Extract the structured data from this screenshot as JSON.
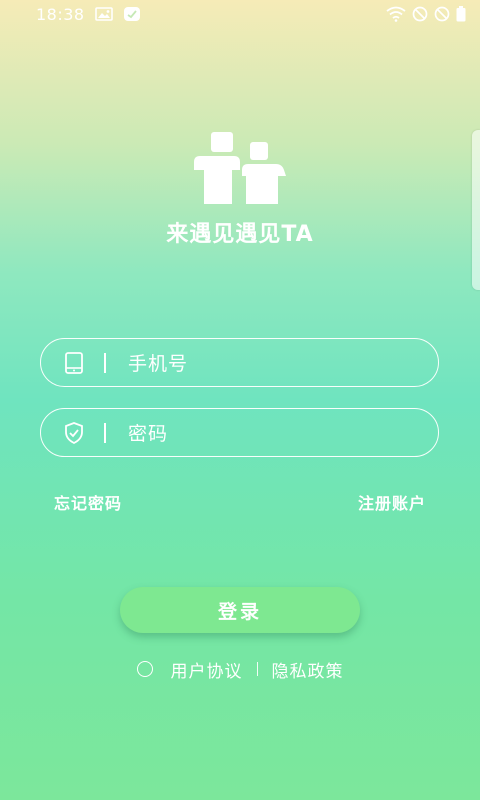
{
  "status_bar": {
    "time": "18:38",
    "left_icons": [
      "image-icon",
      "app-notification-icon"
    ],
    "right_icons": [
      "wifi-icon",
      "no-sim-icon",
      "no-signal-icon",
      "battery-icon"
    ]
  },
  "app": {
    "title": "来遇见遇见TA"
  },
  "form": {
    "phone_placeholder": "手机号",
    "password_placeholder": "密码"
  },
  "links": {
    "forgot_password": "忘记密码",
    "register": "注册账户"
  },
  "login_button": "登录",
  "agreement": {
    "user_agreement": "用户协议",
    "privacy_policy": "隐私政策",
    "checked": false
  },
  "colors": {
    "button": "#7ee891",
    "text": "#ffffff"
  }
}
